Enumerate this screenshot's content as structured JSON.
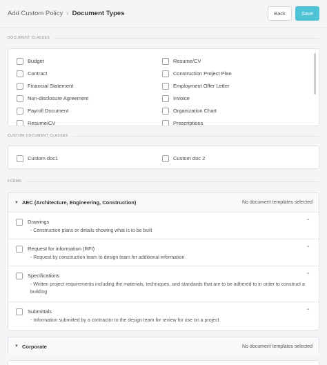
{
  "breadcrumb": {
    "root": "Add Custom Policy",
    "separator": "›",
    "current": "Document Types"
  },
  "actions": {
    "back_label": "Back",
    "save_label": "Save"
  },
  "sections": {
    "document_classes": "DOCUMENT CLASSES",
    "custom_document_classes": "CUSTOM DOCUMENT CLASSES",
    "forms": "FORMS"
  },
  "document_classes": {
    "left": [
      "Budget",
      "Contract",
      "Financial Statement",
      "Non-disclosure Agreement",
      "Payroll Document",
      "Resume/CV"
    ],
    "right": [
      "Resume/CV",
      "Construction Project Plan",
      "Employment Offer Letter",
      "Invoice",
      "Organization Chart",
      "Prescriptions"
    ]
  },
  "custom_document_classes": [
    "Custom doc1",
    "Custom doc 2"
  ],
  "forms": {
    "aec": {
      "title": "AEC (Architecture, Engineering, Construction)",
      "status": "No document templates selected",
      "items": [
        {
          "title": "Drawings",
          "description": "- Construction plans or details showing what is to be built"
        },
        {
          "title": "Request for information (RFI)",
          "description": "- Request by construction team to design team for additional information"
        },
        {
          "title": "Specifications",
          "description": "- Written project requirements including the materials, techniques, and standards that are to be adhered to in order to construct a building"
        },
        {
          "title": "Submittals",
          "description": "- Information submitted by a contractor to the design team for review for use on a project"
        }
      ]
    },
    "corporate": {
      "title": "Corporate",
      "status": "No document templates selected"
    }
  },
  "icons": {
    "expand": "caret-down-icon",
    "collapse": "chevron-up-icon"
  },
  "colors": {
    "accent": "#4fc3d6"
  }
}
